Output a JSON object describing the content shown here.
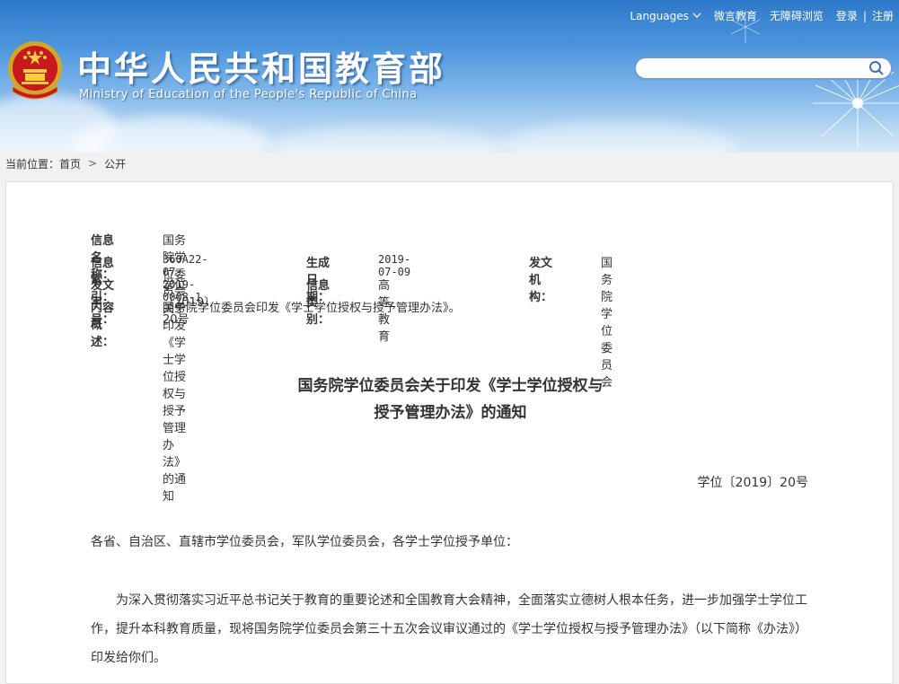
{
  "header": {
    "title": "中华人民共和国教育部",
    "subtitle": "Ministry of Education of the People's Republic of China",
    "nav": {
      "languages": "Languages",
      "weiyan": "微言教育",
      "accessibility": "无障碍浏览",
      "login": "登录",
      "separator": "|",
      "register": "注册"
    },
    "search": {
      "placeholder": "",
      "icon": "search-icon"
    }
  },
  "breadcrumb": {
    "prefix": "当前位置：",
    "home": "首页",
    "chevron": ">",
    "current": "公开"
  },
  "info": {
    "name_label": "信息名称：",
    "name_value": "国务院学位委员会关于印发《学士学位授权与授予管理办法》的通知",
    "index_label": "信息索引：",
    "index_value": "360A22-07-2019-0008-1",
    "date_label": "生成日期：",
    "date_value": "2019-07-09",
    "org_label": "发文机构：",
    "org_value": "国务院学位委员会",
    "docno_label": "发文字号：",
    "docno_value": "学位〔2019〕20号",
    "category_label": "信息类别：",
    "category_value": "高等教育",
    "summary_label": "内容概述：",
    "summary_value": "国务院学位委员会印发《学士学位授权与授予管理办法》。"
  },
  "document": {
    "title_line1": "国务院学位委员会关于印发《学士学位授权与",
    "title_line2": "授予管理办法》的通知",
    "number": "学位〔2019〕20号",
    "addressee": "各省、自治区、直辖市学位委员会，军队学位委员会，各学士学位授予单位：",
    "paragraph1": "为深入贯彻落实习近平总书记关于教育的重要论述和全国教育大会精神，全面落实立德树人根本任务，进一步加强学士学位工作，提升本科教育质量，现将国务院学位委员会第三十五次会议审议通过的《学士学位授权与授予管理办法》（以下简称《办法》）印发给你们。"
  }
}
